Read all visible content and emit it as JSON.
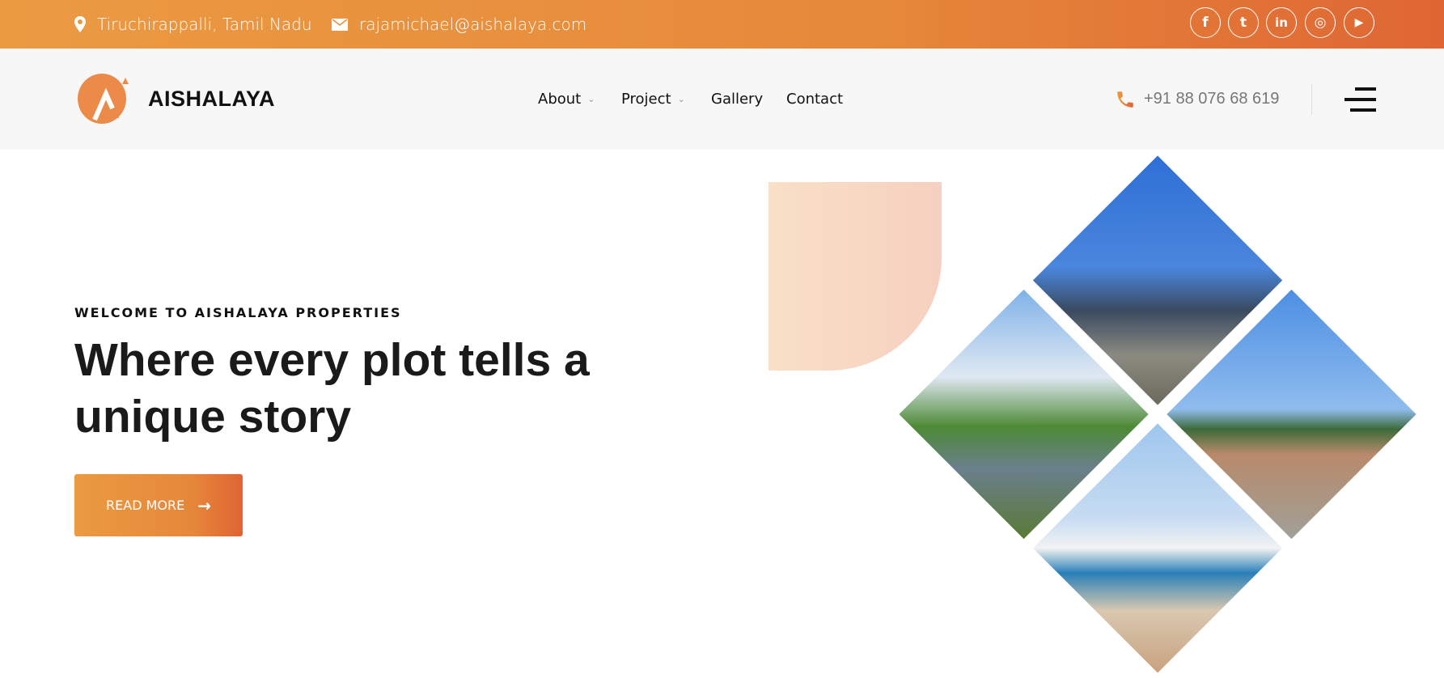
{
  "topbar": {
    "location": "Tiruchirappalli, Tamil Nadu",
    "email": "rajamichael@aishalaya.com",
    "social": [
      {
        "icon": "facebook-icon",
        "glyph": "f"
      },
      {
        "icon": "twitter-icon",
        "glyph": "t"
      },
      {
        "icon": "linkedin-icon",
        "glyph": "in"
      },
      {
        "icon": "instagram-icon",
        "glyph": "◎"
      },
      {
        "icon": "youtube-icon",
        "glyph": "▶"
      }
    ]
  },
  "nav": {
    "logo_text": "AISHALAYA",
    "menu": [
      {
        "label": "About",
        "dropdown": true
      },
      {
        "label": "Project",
        "dropdown": true
      },
      {
        "label": "Gallery",
        "dropdown": false
      },
      {
        "label": "Contact",
        "dropdown": false
      }
    ],
    "chevron": "⌄",
    "phone": "+91 88 076 68 619"
  },
  "hero": {
    "eyebrow": "WELCOME TO AISHALAYA PROPERTIES",
    "headline": "Where every plot tells a unique story",
    "button_label": "READ MORE",
    "button_arrow": "→"
  },
  "colors": {
    "accent_start": "#eb9a42",
    "accent_end": "#df6434",
    "text": "#1a1a1a"
  }
}
